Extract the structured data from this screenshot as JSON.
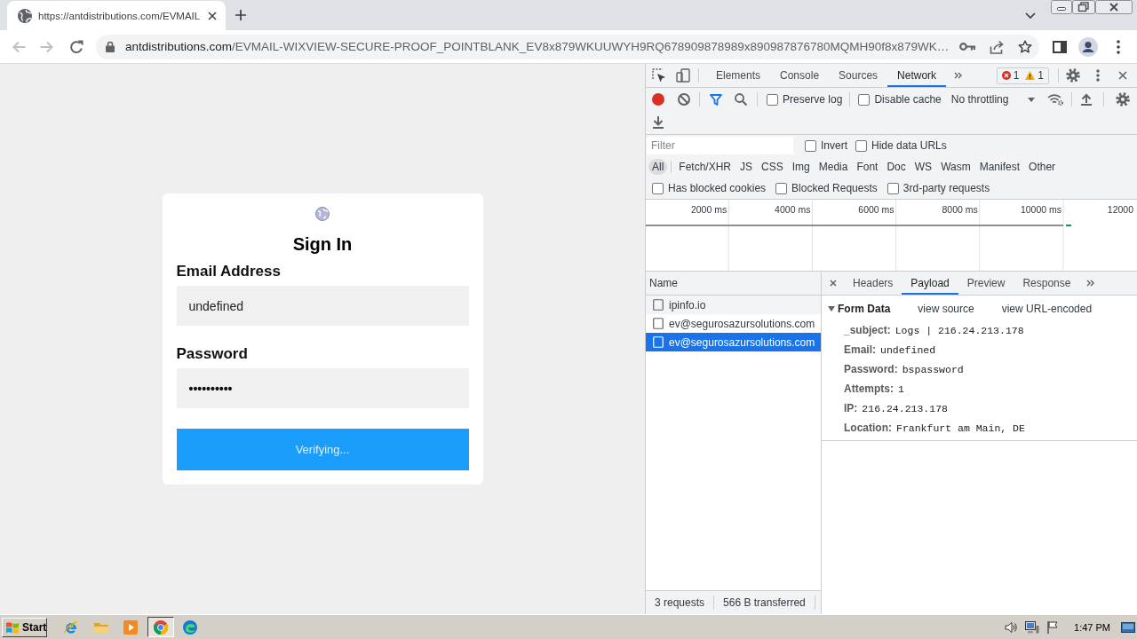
{
  "browser": {
    "tabs": [
      {
        "title": "https://antdistributions.com/EVMAIL",
        "selected": true
      }
    ],
    "nav_buttons": [
      {
        "kind": "back",
        "disabled": true
      },
      {
        "kind": "forward",
        "disabled": true
      },
      {
        "kind": "reload",
        "disabled": false
      }
    ],
    "address": {
      "host": "antdistributions.com",
      "path": "/EVMAIL-WIXVIEW-SECURE-PROOF_POINTBLANK_EV8x879WKUUWYH9RQ678909878989x890987876780MQMH90f8x879WK…"
    }
  },
  "page": {
    "title": "Sign In",
    "fields": [
      {
        "kind": "text",
        "label": "Email Address",
        "value": "undefined"
      },
      {
        "kind": "password",
        "label": "Password",
        "value": "••••••••••"
      }
    ],
    "button": "Verifying..."
  },
  "devtools": {
    "tabs": [
      {
        "label": "Elements",
        "selected": false
      },
      {
        "label": "Console",
        "selected": false
      },
      {
        "label": "Sources",
        "selected": false
      },
      {
        "label": "Network",
        "selected": true
      }
    ],
    "issues": {
      "errors": "1",
      "warnings": "1"
    },
    "network": {
      "recording": true,
      "options": [
        {
          "label": "Preserve log",
          "checked": false
        },
        {
          "label": "Disable cache",
          "checked": false
        }
      ],
      "throttling": "No throttling",
      "filter": {
        "placeholder": "Filter",
        "options": [
          {
            "label": "Invert",
            "checked": false
          },
          {
            "label": "Hide data URLs",
            "checked": false
          }
        ]
      },
      "types": [
        {
          "label": "All",
          "selected": true
        },
        {
          "label": "Fetch/XHR",
          "selected": false
        },
        {
          "label": "JS",
          "selected": false
        },
        {
          "label": "CSS",
          "selected": false
        },
        {
          "label": "Img",
          "selected": false
        },
        {
          "label": "Media",
          "selected": false
        },
        {
          "label": "Font",
          "selected": false
        },
        {
          "label": "Doc",
          "selected": false
        },
        {
          "label": "WS",
          "selected": false
        },
        {
          "label": "Wasm",
          "selected": false
        },
        {
          "label": "Manifest",
          "selected": false
        },
        {
          "label": "Other",
          "selected": false
        }
      ],
      "request_options": [
        {
          "label": "Has blocked cookies",
          "checked": false
        },
        {
          "label": "Blocked Requests",
          "checked": false
        },
        {
          "label": "3rd-party requests",
          "checked": false
        }
      ],
      "timeline": {
        "ticks": [
          "2000 ms",
          "4000 ms",
          "6000 ms",
          "8000 ms",
          "10000 ms",
          "12000"
        ]
      },
      "requests": {
        "column": "Name",
        "rows": [
          {
            "name": "ipinfo.io",
            "selected": false
          },
          {
            "name": "ev@segurosazursolutions.com",
            "selected": false
          },
          {
            "name": "ev@segurosazursolutions.com",
            "selected": true
          }
        ],
        "summary": [
          "3 requests",
          "566 B transferred"
        ]
      },
      "details": {
        "tabs": [
          {
            "label": "Headers",
            "selected": false
          },
          {
            "label": "Payload",
            "selected": true
          },
          {
            "label": "Preview",
            "selected": false
          },
          {
            "label": "Response",
            "selected": false
          }
        ],
        "section": {
          "title": "Form Data",
          "expanded": true,
          "links": [
            "view source",
            "view URL-encoded"
          ],
          "fields": [
            {
              "key": "_subject:",
              "value": "Logs | 216.24.213.178"
            },
            {
              "key": "Email:",
              "value": "undefined"
            },
            {
              "key": "Password:",
              "value": "bspassword"
            },
            {
              "key": "Attempts:",
              "value": "1"
            },
            {
              "key": "IP:",
              "value": "216.24.213.178"
            },
            {
              "key": "Location:",
              "value": "Frankfurt am Main, DE"
            }
          ]
        }
      }
    }
  },
  "taskbar": {
    "start": "Start",
    "apps": [
      {
        "kind": "ie",
        "selected": false
      },
      {
        "kind": "folder",
        "selected": false
      },
      {
        "kind": "media",
        "selected": false
      },
      {
        "kind": "chrome",
        "selected": true
      },
      {
        "kind": "edge",
        "selected": false
      }
    ],
    "clock": "1:47 PM"
  }
}
